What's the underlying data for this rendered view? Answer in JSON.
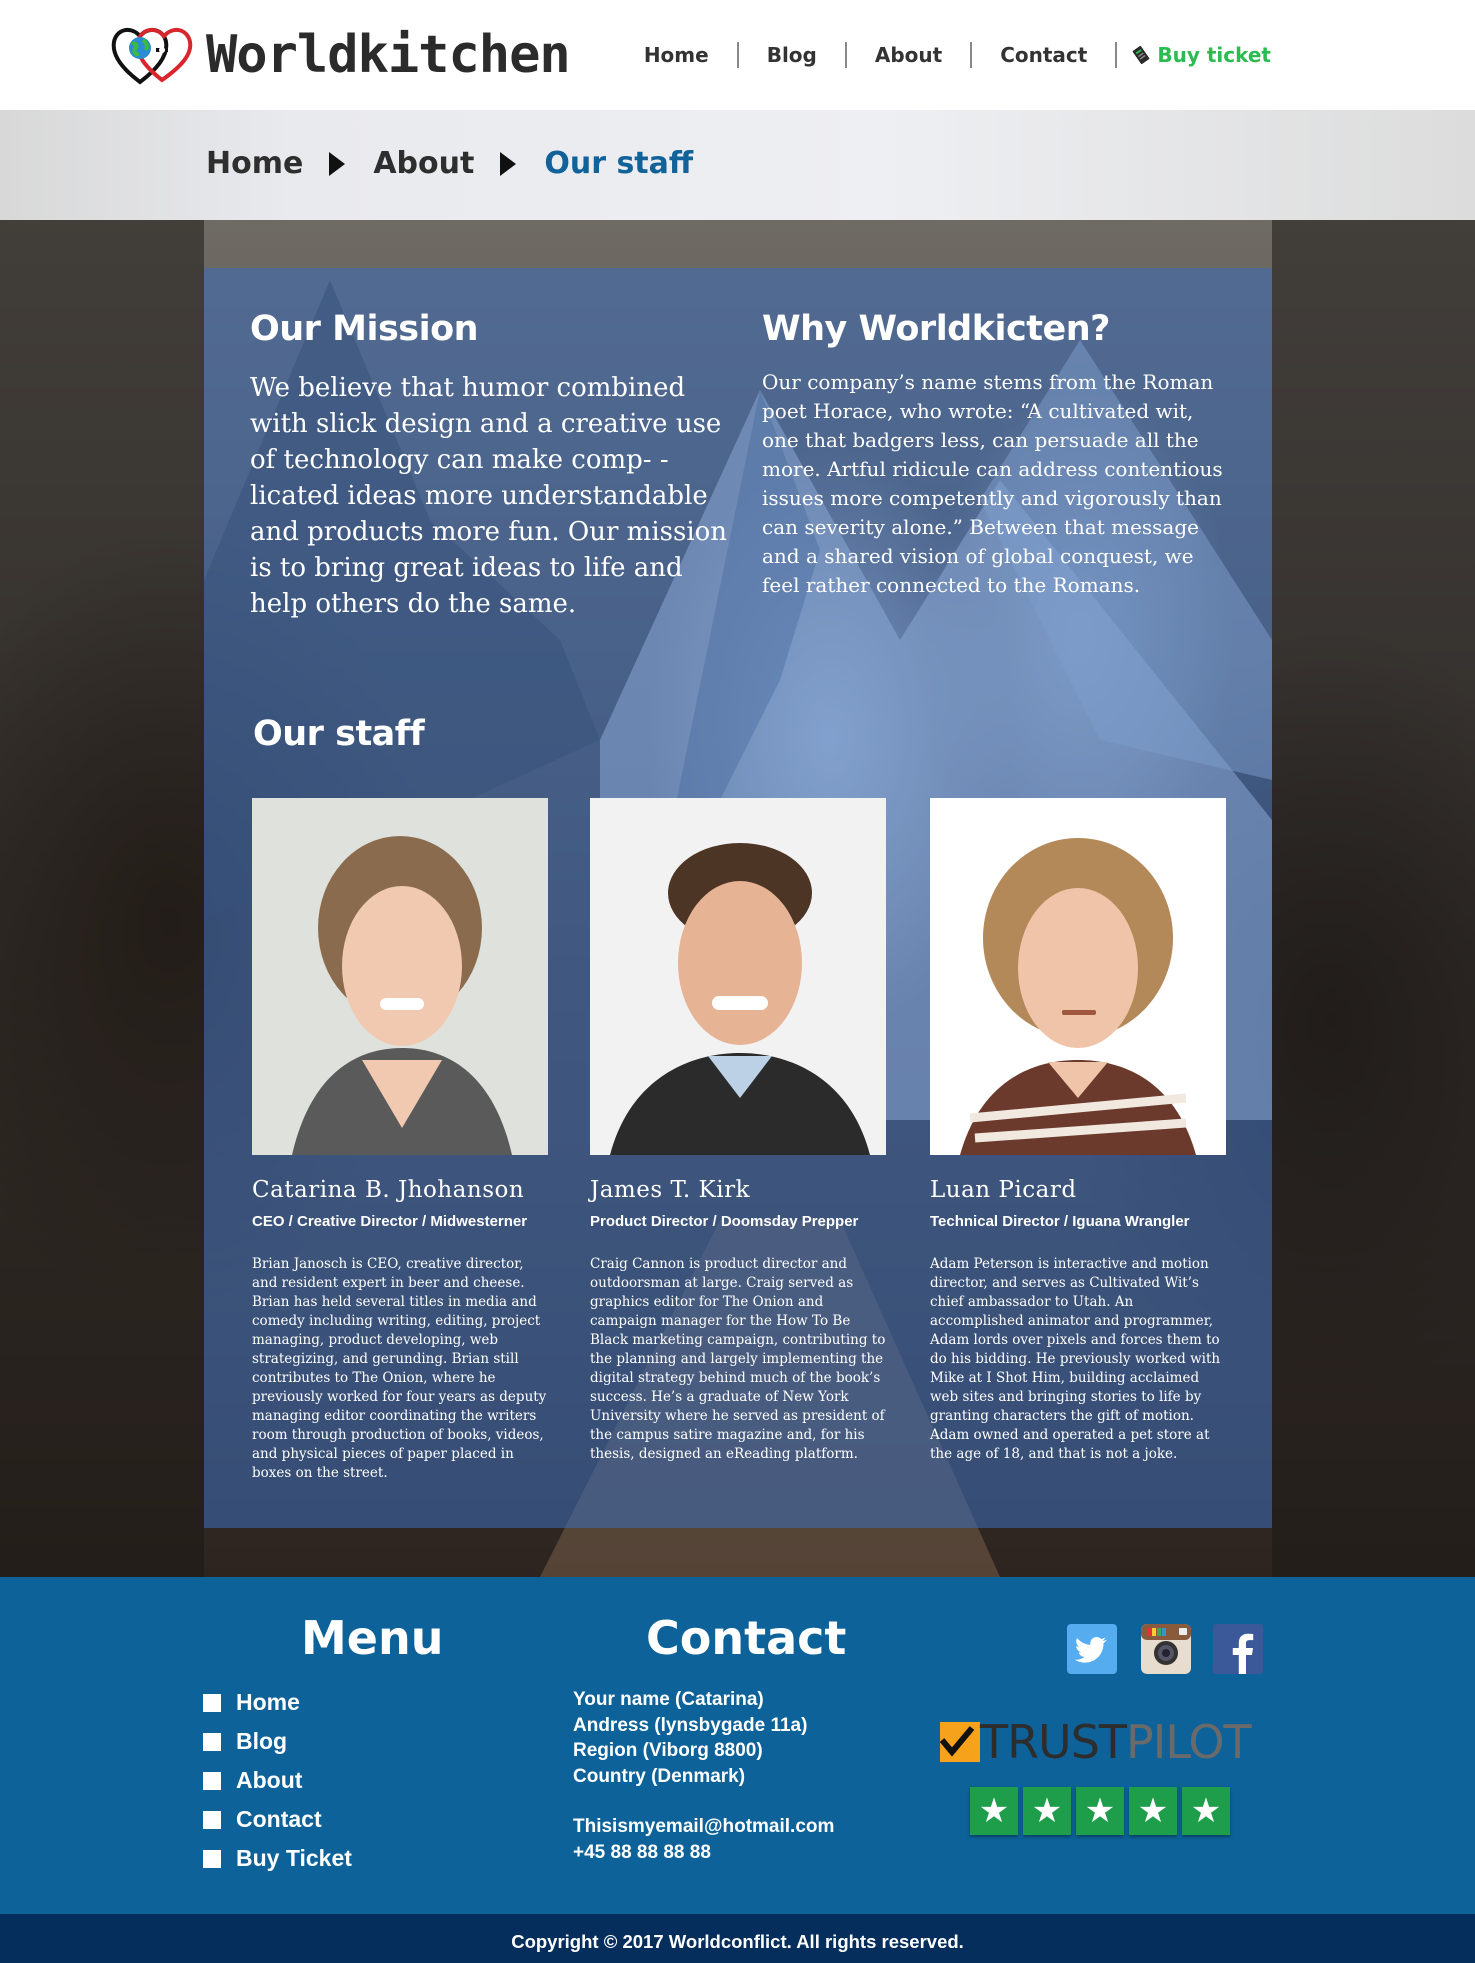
{
  "brand": {
    "name": "Worldkitchen"
  },
  "nav": {
    "items": [
      {
        "label": "Home"
      },
      {
        "label": "Blog"
      },
      {
        "label": "About"
      },
      {
        "label": "Contact"
      }
    ],
    "buy_ticket": "Buy ticket"
  },
  "breadcrumb": [
    "Home",
    "About",
    "Our staff"
  ],
  "mission": {
    "title": "Our Mission",
    "text": "We believe that humor combined with slick design and a creative use of technology can make comp- -licated ideas more understandable and products more fun. Our mission is to bring great ideas to life and help others do the same."
  },
  "why": {
    "title": "Why Worldkicten?",
    "text": "Our company’s name stems from the Roman poet Horace, who wrote: “A cultivated wit, one that badgers less, can persuade all the more. Artful ridicule can address contentious issues more competently and vigorously than can severity alone.” Between that message and a shared vision of global conquest, we feel rather connected to the Romans."
  },
  "staff": {
    "title": "Our  staff",
    "members": [
      {
        "name": "Catarina B. Jhohanson",
        "role": "CEO / Creative Director / Midwesterner",
        "bio": "Brian Janosch is CEO, creative director, and resident expert in beer and cheese. Brian has held several titles in media and comedy including writing, editing, project managing, product developing, web strategizing, and gerunding. Brian still contributes to The Onion, where he previously worked for four years as deputy managing editor coordinating the writers room through production of books, videos, and physical pieces of paper placed in boxes on the street."
      },
      {
        "name": "James T. Kirk",
        "role": "Product Director / Doomsday Prepper",
        "bio": "Craig Cannon is product director and outdoorsman at large. Craig served as graphics editor for The Onion and campaign manager for the How To Be Black marketing campaign, contributing to the planning and largely implementing the digital strategy behind much of the book’s success. He’s a graduate of New York University where he served as president of the campus satire magazine and, for his thesis, designed an eReading platform."
      },
      {
        "name": "Luan Picard",
        "role": "Technical Director / Iguana Wrangler",
        "bio": "Adam Peterson is interactive and motion director, and serves as Cultivated Wit’s chief ambassador to Utah. An accomplished animator and programmer, Adam lords over pixels and forces them to do his bidding. He previously worked with Mike at I Shot Him, building acclaimed web sites and bringing stories to life by granting characters the gift of motion. Adam owned and operated a pet store at the age of 18, and that is not a joke."
      }
    ]
  },
  "footer": {
    "menu_title": "Menu",
    "menu_items": [
      "Home",
      "Blog",
      "About",
      "Contact",
      "Buy Ticket"
    ],
    "contact_title": "Contact",
    "contact_lines": [
      "Your name (Catarina)",
      "Andress (lynsbygade 11a)",
      "Region (Viborg 8800)",
      "Country (Denmark)"
    ],
    "email": "Thisismyemail@hotmail.com",
    "phone": "+45 88 88 88 88",
    "social_icons": [
      "twitter-icon",
      "instagram-icon",
      "facebook-icon"
    ],
    "trustpilot": {
      "trust": "TRUST",
      "pilot": "PILOT",
      "stars": 5
    },
    "copyright": "Copyright © 2017 Worldconflict.  All rights reserved."
  },
  "colors": {
    "accent_blue": "#12629a",
    "footer_blue": "#0c6299",
    "copyright_bg": "#062e5d",
    "buy_green": "#2cbb4f",
    "trust_green": "#1e9e4b"
  }
}
